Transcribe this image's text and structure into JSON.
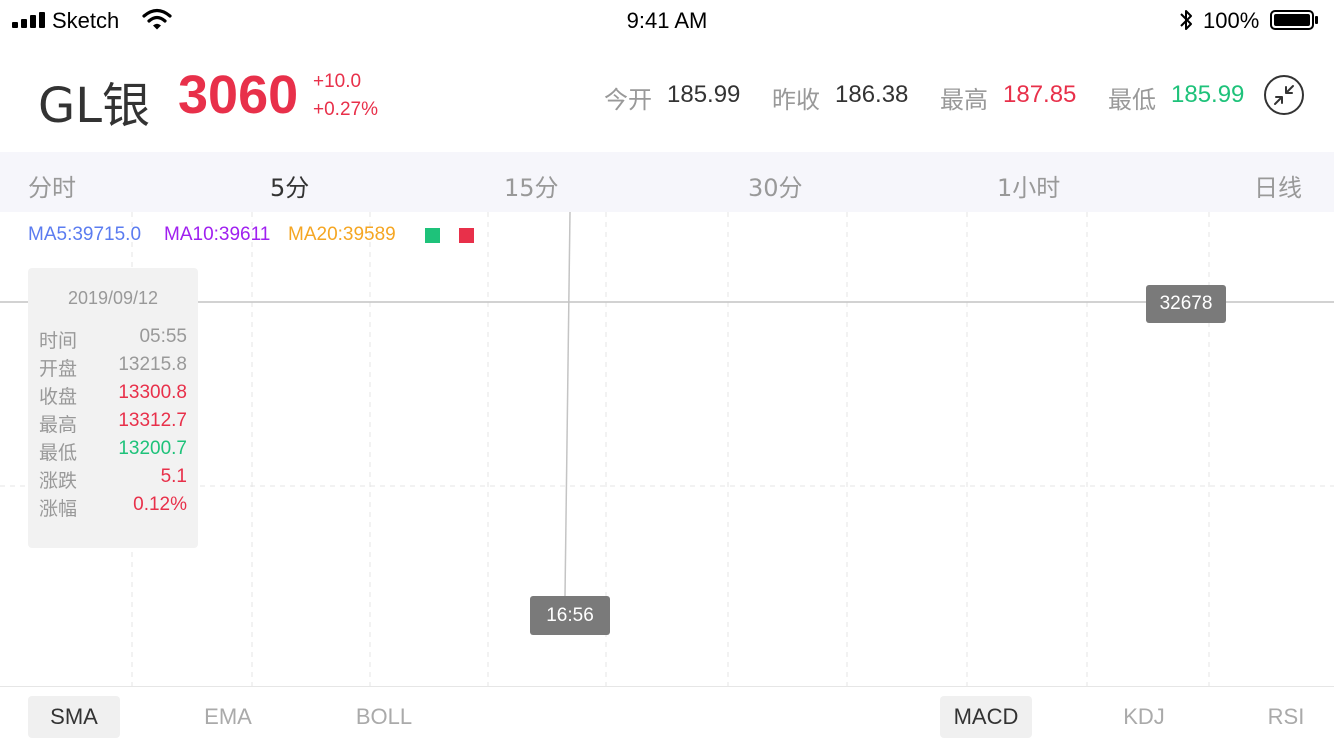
{
  "status_bar": {
    "carrier": "Sketch",
    "time": "9:41 AM",
    "battery": "100%"
  },
  "quote": {
    "symbol": "GL银",
    "price": "3060",
    "change": "+10.0",
    "change_pct": "+0.27%",
    "stats": [
      {
        "label": "今开",
        "value": "185.99",
        "color": "#333333"
      },
      {
        "label": "昨收",
        "value": "186.38",
        "color": "#333333"
      },
      {
        "label": "最高",
        "value": "187.85",
        "color": "#e8304a"
      },
      {
        "label": "最低",
        "value": "185.99",
        "color": "#1ec27a"
      }
    ]
  },
  "period_tabs": [
    {
      "label": "分时",
      "active": false
    },
    {
      "label": "5分",
      "active": true
    },
    {
      "label": "15分",
      "active": false
    },
    {
      "label": "30分",
      "active": false
    },
    {
      "label": "1小时",
      "active": false
    },
    {
      "label": "日线",
      "active": false
    }
  ],
  "chart": {
    "ma": [
      {
        "label": "MA5:39715.0",
        "color": "#5b7cf0"
      },
      {
        "label": "MA10:39611",
        "color": "#a020f0"
      },
      {
        "label": "MA20:39589",
        "color": "#f5a623"
      }
    ],
    "legend_colors": {
      "rise": "#1ec27a",
      "fall": "#e8304a"
    },
    "crosshair_price": "32678",
    "crosshair_time": "16:56",
    "info": {
      "date": "2019/09/12",
      "rows": [
        {
          "label": "时间",
          "value": "05:55",
          "color": "#999999"
        },
        {
          "label": "开盘",
          "value": "13215.8",
          "color": "#999999"
        },
        {
          "label": "收盘",
          "value": "13300.8",
          "color": "#e8304a"
        },
        {
          "label": "最高",
          "value": "13312.7",
          "color": "#e8304a"
        },
        {
          "label": "最低",
          "value": "13200.7",
          "color": "#1ec27a"
        },
        {
          "label": "涨跌",
          "value": "5.1",
          "color": "#e8304a"
        },
        {
          "label": "涨幅",
          "value": "0.12%",
          "color": "#e8304a"
        }
      ]
    }
  },
  "indicators": {
    "main": [
      {
        "label": "SMA",
        "active": true
      },
      {
        "label": "EMA",
        "active": false
      },
      {
        "label": "BOLL",
        "active": false
      }
    ],
    "sub": [
      {
        "label": "MACD",
        "active": true
      },
      {
        "label": "KDJ",
        "active": false
      },
      {
        "label": "RSI",
        "active": false
      }
    ]
  }
}
